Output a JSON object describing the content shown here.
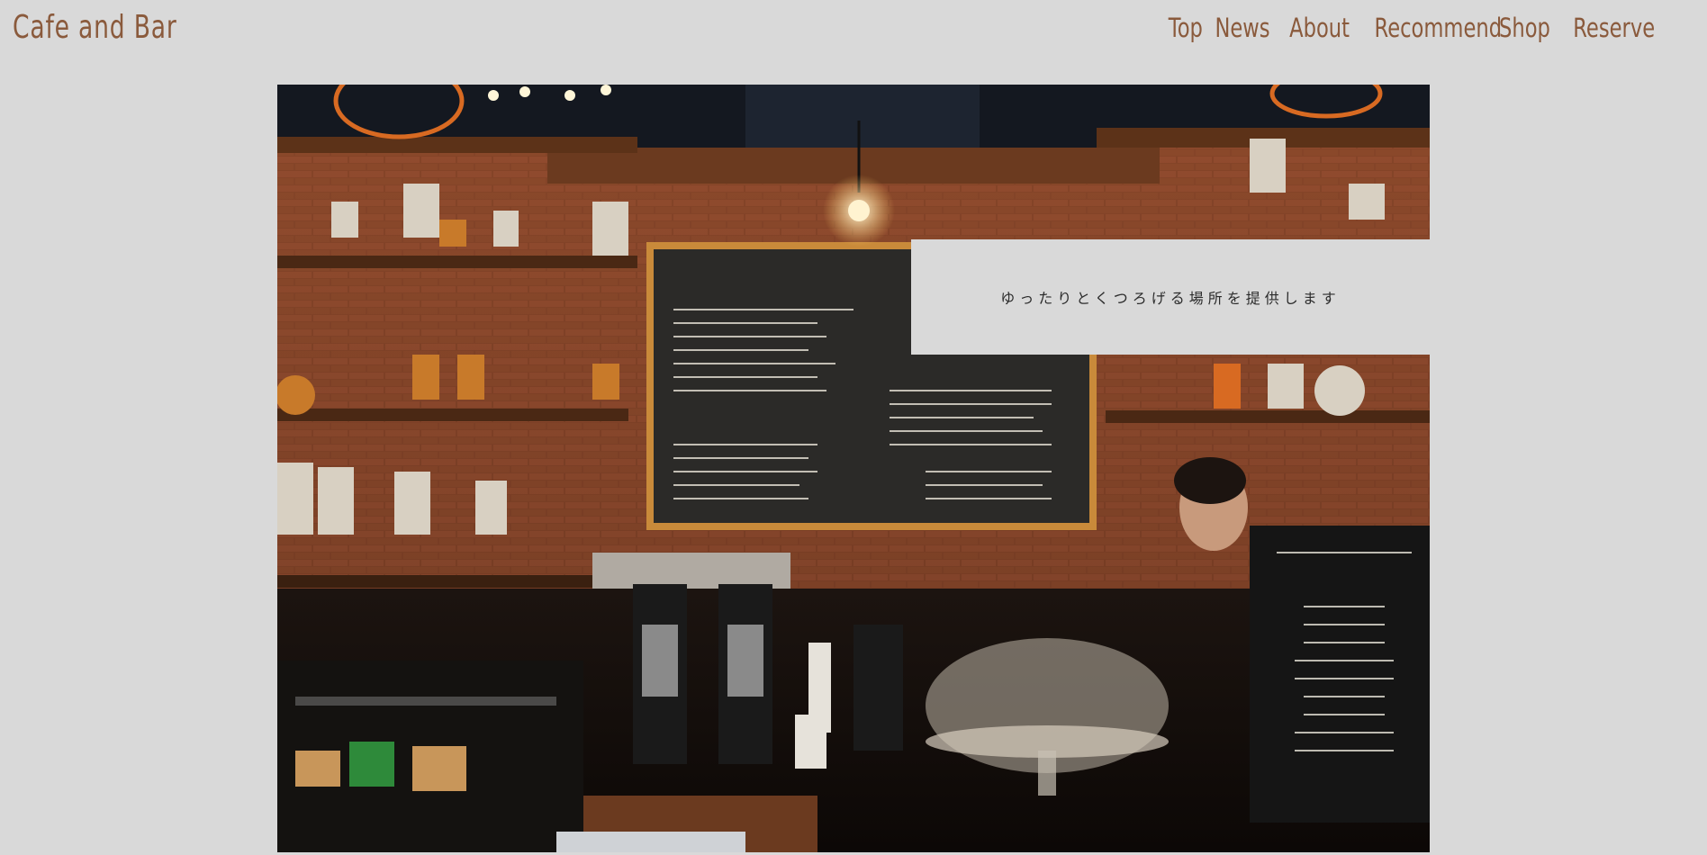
{
  "header": {
    "title": "Cafe and Bar"
  },
  "nav": {
    "items": [
      "Top",
      "News",
      "About",
      "Recommend",
      "Shop",
      "Reserve"
    ]
  },
  "hero": {
    "caption": "ゆったりとくつろげる場所を提供します"
  },
  "colors": {
    "background": "#d9d9d9",
    "brand": "#8a5a3c",
    "caption_text": "#2b2b2b"
  }
}
